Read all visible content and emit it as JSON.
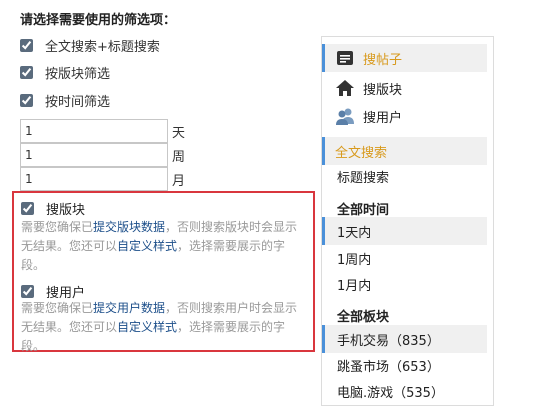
{
  "title": "请选择需要使用的筛选项：",
  "options": [
    {
      "label": "全文搜索+标题搜索",
      "checked": true
    },
    {
      "label": "按版块筛选",
      "checked": true
    },
    {
      "label": "按时间筛选",
      "checked": true
    }
  ],
  "time_inputs": [
    {
      "value": "1",
      "unit": "天"
    },
    {
      "value": "1",
      "unit": "周"
    },
    {
      "value": "1",
      "unit": "月"
    }
  ],
  "forum_block": {
    "label": "搜版块",
    "checked": true,
    "note_pre": "需要您确保已",
    "link1": "提交版块数据",
    "note_mid": "，否则搜索版块时会显示无结果。您还可以",
    "link2": "自定义样式",
    "note_post": "，选择需要展示的字段。"
  },
  "user_block": {
    "label": "搜用户",
    "checked": true,
    "note_pre": "需要您确保已",
    "link1": "提交用户数据",
    "note_mid": "，否则搜索用户时会显示无结果。您还可以",
    "link2": "自定义样式",
    "note_post": "，选择需要展示的字段。"
  },
  "sidebar": {
    "search_types": [
      {
        "label": "搜帖子",
        "icon": "post-icon"
      },
      {
        "label": "搜版块",
        "icon": "home-icon"
      },
      {
        "label": "搜用户",
        "icon": "users-icon"
      }
    ],
    "scope": [
      "全文搜索",
      "标题搜索"
    ],
    "time_head": "全部时间",
    "times": [
      "1天内",
      "1周内",
      "1月内"
    ],
    "forum_head": "全部板块",
    "forums": [
      "手机交易（835）",
      "跳蚤市场（653）",
      "电脑.游戏（535）"
    ],
    "colors": {
      "active_text": "#d89a1d",
      "accent": "#4a90d9"
    }
  }
}
